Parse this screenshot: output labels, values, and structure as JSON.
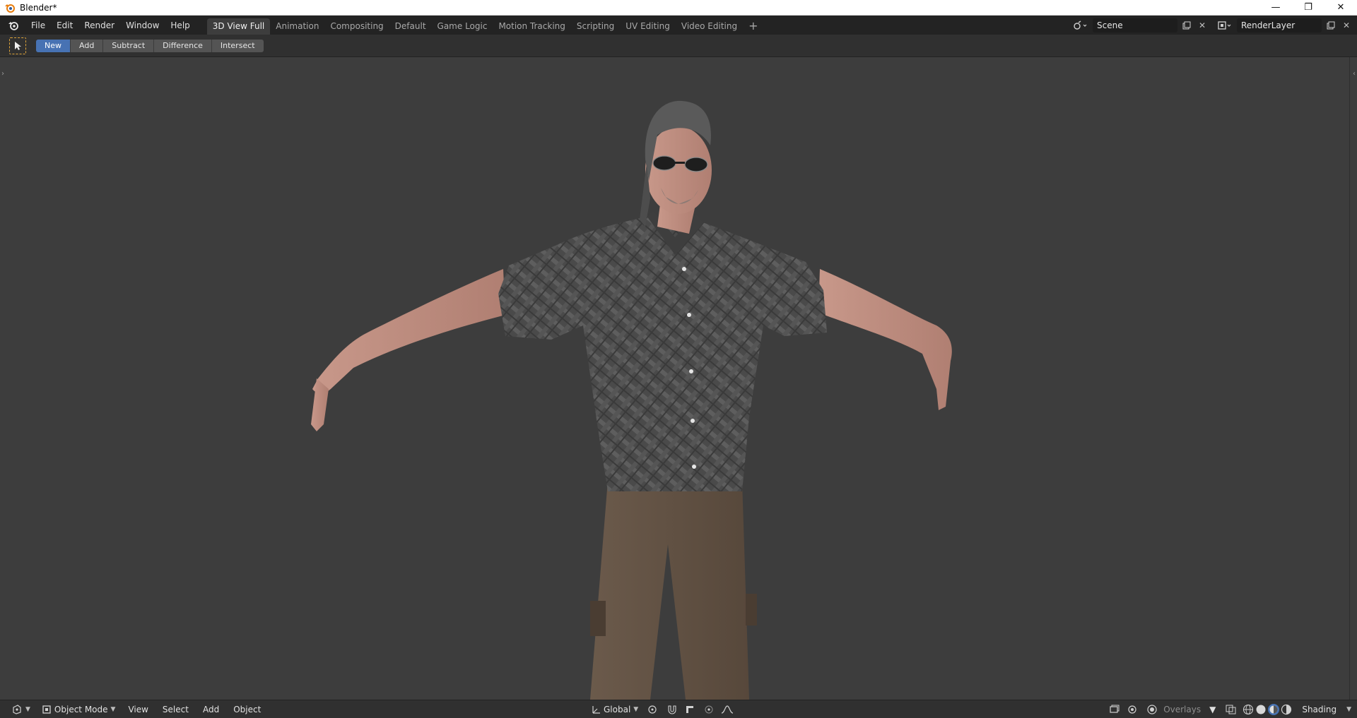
{
  "window": {
    "title": "Blender*",
    "controls": {
      "minimize": "—",
      "restore": "❐",
      "close": "✕"
    }
  },
  "menus": [
    "File",
    "Edit",
    "Render",
    "Window",
    "Help"
  ],
  "workspaces": {
    "active_index": 0,
    "tabs": [
      "3D View Full",
      "Animation",
      "Compositing",
      "Default",
      "Game Logic",
      "Motion Tracking",
      "Scripting",
      "UV Editing",
      "Video Editing"
    ],
    "add_label": "+"
  },
  "scene": {
    "name": "Scene"
  },
  "render_layer": {
    "name": "RenderLayer"
  },
  "tool_header": {
    "modes": [
      "New",
      "Add",
      "Subtract",
      "Difference",
      "Intersect"
    ],
    "active_mode_index": 0
  },
  "bottom_header": {
    "mode": "Object Mode",
    "menus": [
      "View",
      "Select",
      "Add",
      "Object"
    ],
    "transform_orientation": "Global",
    "overlays_label": "Overlays",
    "shading_label": "Shading"
  },
  "colors": {
    "accent": "#4772b3",
    "viewport_bg": "#3d3d3d",
    "header_bg": "#303030",
    "topbar_bg": "#232323",
    "select_outline": "#e0a53a"
  },
  "icons": {
    "app": "blender-icon",
    "select_tool": "select-box-icon",
    "editor_type": "viewport-editor-icon"
  }
}
